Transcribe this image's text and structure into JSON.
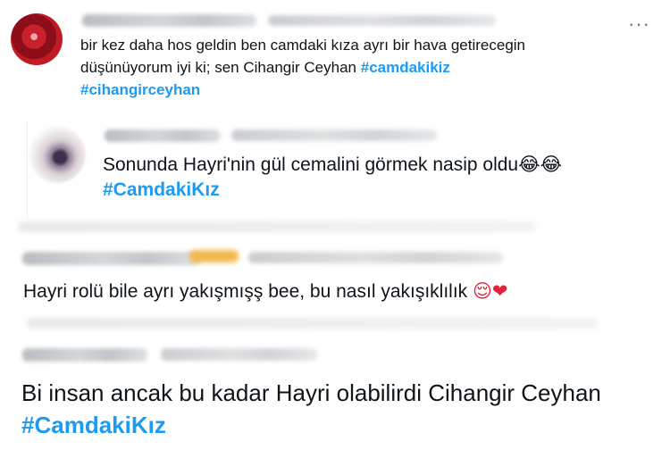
{
  "tweets": [
    {
      "more_label": "···",
      "lines": [
        "bir kez daha hos geldin ben camdaki kıza ayrı bir hava getirecegin",
        "düşünüyorum iyi ki; sen Cihangir Ceyhan"
      ],
      "hashtags": [
        "#camdakikiz",
        "#cihangirceyhan"
      ]
    },
    {
      "lines": [
        "Sonunda Hayri'nin gül cemalini görmek nasip oldu"
      ],
      "emoji": "😂😂",
      "hashtags": [
        "#CamdakiKız"
      ]
    },
    {
      "lines": [
        "Hayri rolü bile ayrı yakışmışş bee, bu nasıl yakışıklılık"
      ],
      "emoji": "😌❤"
    },
    {
      "lines": [
        "Bi insan ancak bu kadar Hayri olabilirdi Cihangir Ceyhan"
      ],
      "hashtags": [
        "#CamdakiKız"
      ]
    }
  ],
  "colors": {
    "hashtag": "#1d9bf0",
    "text": "#0f1419",
    "heart": "#e0243a"
  },
  "icons": [
    "more-options-icon"
  ]
}
